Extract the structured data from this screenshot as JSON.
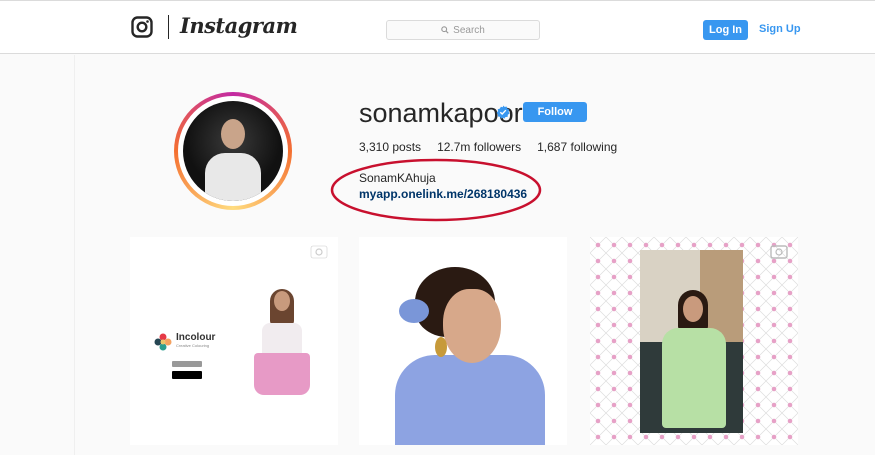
{
  "header": {
    "wordmark": "Instagram",
    "search_placeholder": "Search",
    "login_label": "Log In",
    "signup_label": "Sign Up"
  },
  "profile": {
    "username": "sonamkapoor",
    "follow_label": "Follow",
    "stats": {
      "posts_count": "3,310",
      "posts_label": "posts",
      "followers_count": "12.7m",
      "followers_label": "followers",
      "following_count": "1,687",
      "following_label": "following"
    },
    "bio_name": "SonamKAhuja",
    "bio_link": "myapp.onelink.me/268180436"
  },
  "posts": [
    {
      "brand_title": "Incolour",
      "brand_sub": "Creative Colouring",
      "is_video": true
    },
    {
      "is_video": false
    },
    {
      "is_video": true
    }
  ],
  "colors": {
    "accent": "#3897f0",
    "link": "#003569",
    "annotation": "#c8102e"
  }
}
